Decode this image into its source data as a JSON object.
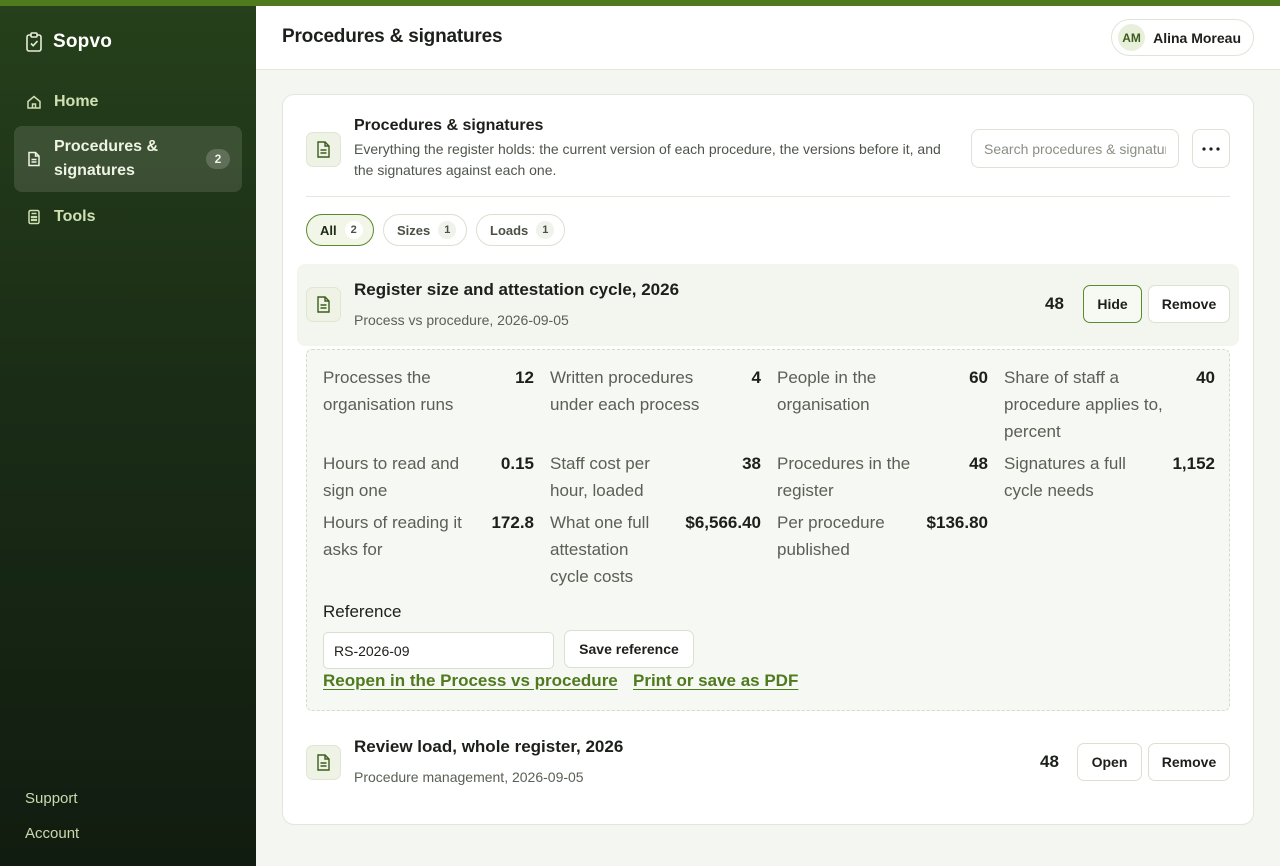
{
  "app": {
    "name": "Sopvo"
  },
  "sidebar": {
    "items": [
      {
        "label": "Home",
        "icon": "home-icon"
      },
      {
        "label": "Procedures & signatures",
        "icon": "document-icon",
        "badge": "2",
        "active": true
      },
      {
        "label": "Tools",
        "icon": "calculator-icon"
      }
    ],
    "footer": {
      "support": "Support",
      "account": "Account"
    }
  },
  "header": {
    "title": "Procedures & signatures",
    "user": {
      "initials": "AM",
      "name": "Alina Moreau"
    }
  },
  "card": {
    "title": "Procedures & signatures",
    "description": "Everything the register holds: the current version of each procedure, the versions before it, and the signatures against each one.",
    "search_placeholder": "Search procedures & signatures",
    "filters": [
      {
        "label": "All",
        "count": "2",
        "active": true
      },
      {
        "label": "Sizes",
        "count": "1"
      },
      {
        "label": "Loads",
        "count": "1"
      }
    ],
    "items": [
      {
        "title": "Register size and attestation cycle, 2026",
        "subtitle": "Process vs procedure, 2026-09-05",
        "count": "48",
        "hide_label": "Hide",
        "remove_label": "Remove",
        "metrics": [
          {
            "label": "Processes the organisation runs",
            "value": "12"
          },
          {
            "label": "Written procedures under each process",
            "value": "4"
          },
          {
            "label": "People in the organisation",
            "value": "60"
          },
          {
            "label": "Share of staff a procedure applies to, percent",
            "value": "40"
          },
          {
            "label": "Hours to read and sign one",
            "value": "0.15"
          },
          {
            "label": "Staff cost per hour, loaded",
            "value": "38"
          },
          {
            "label": "Procedures in the register",
            "value": "48"
          },
          {
            "label": "Signatures a full cycle needs",
            "value": "1,152"
          },
          {
            "label": "Hours of reading it asks for",
            "value": "172.8"
          },
          {
            "label": "What one full attestation cycle costs",
            "value": "$6,566.40"
          },
          {
            "label": "Per procedure published",
            "value": "$136.80"
          }
        ],
        "reference_label": "Reference",
        "reference_value": "RS-2026-09",
        "save_reference_label": "Save reference",
        "reopen_link": "Reopen in the Process vs procedure",
        "print_link": "Print or save as PDF"
      },
      {
        "title": "Review load, whole register, 2026",
        "subtitle": "Procedure management, 2026-09-05",
        "count": "48",
        "open_label": "Open",
        "remove_label": "Remove"
      }
    ]
  },
  "colors": {
    "accent": "#4f7a1e",
    "sidebar_top": "#26401b",
    "sidebar_bottom": "#111c10"
  }
}
